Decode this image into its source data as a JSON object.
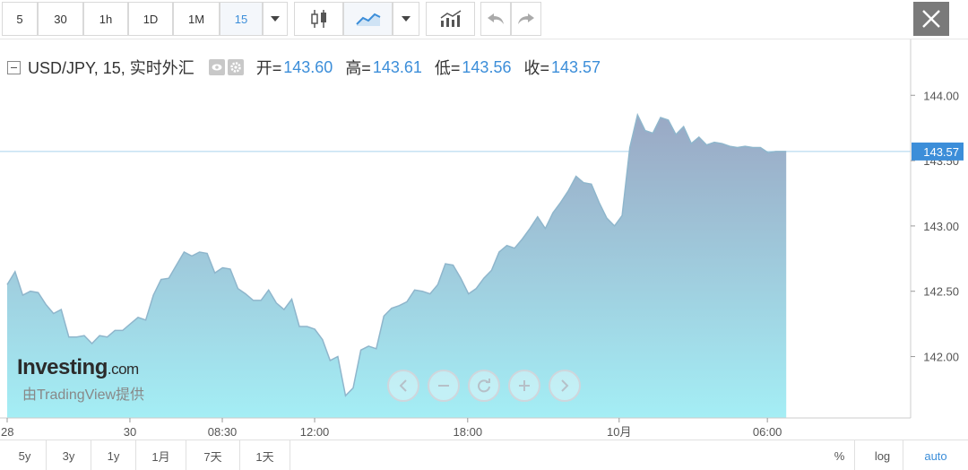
{
  "toolbar": {
    "intervals": [
      "5",
      "30",
      "1h",
      "1D",
      "1M",
      "15"
    ],
    "active_interval": "15"
  },
  "legend": {
    "symbol": "USD/JPY, 15, 实时外汇",
    "open_label": "开=",
    "open": "143.60",
    "high_label": "高=",
    "high": "143.61",
    "low_label": "低=",
    "low": "143.56",
    "close_label": "收=",
    "close": "143.57"
  },
  "brand": {
    "name": "Investing",
    "suffix": ".com",
    "credit": "由TradingView提供"
  },
  "bottom_bar": {
    "ranges": [
      "5y",
      "3y",
      "1y",
      "1月",
      "7天",
      "1天"
    ],
    "scale_options": [
      "%",
      "log",
      "auto"
    ],
    "active_scale": "auto"
  },
  "colors": {
    "accent": "#3c8ed9",
    "area_top": "#9aa8c4",
    "area_bottom": "#a4eef5",
    "line": "#8fb6cc"
  },
  "chart_data": {
    "type": "area",
    "title": "",
    "xlabel": "",
    "ylabel": "",
    "ylim": [
      141.53,
      144.4
    ],
    "y_ticks": [
      142.0,
      142.5,
      143.0,
      143.5,
      144.0
    ],
    "y_tick_labels": [
      "142.00",
      "142.50",
      "143.00",
      "143.50",
      "144.00"
    ],
    "last_price": 143.57,
    "last_price_label": "143.57",
    "x_ticks": [
      {
        "x": 0.0,
        "label": "28"
      },
      {
        "x": 25.45,
        "label": "30"
      },
      {
        "x": 44.6,
        "label": "08:30"
      },
      {
        "x": 63.74,
        "label": "12:00"
      },
      {
        "x": 95.47,
        "label": "18:00"
      },
      {
        "x": 126.87,
        "label": "10月"
      },
      {
        "x": 157.6,
        "label": "06:00"
      }
    ],
    "series": [
      {
        "x": [
          0,
          1.64,
          3.23,
          4.82,
          6.42,
          8.01,
          9.6,
          11.2,
          12.79,
          14.38,
          15.98,
          17.57,
          19.16,
          20.75,
          22.35,
          23.94,
          25.53,
          27.13,
          28.72,
          30.31,
          31.91,
          33.5,
          35.09,
          36.68,
          38.28,
          39.87,
          41.46,
          43.06,
          44.65,
          46.24,
          47.84,
          49.43,
          51.02,
          52.62,
          54.21,
          55.8,
          57.39,
          58.99,
          60.58,
          62.17,
          63.77,
          65.36,
          66.95,
          68.55,
          70.14,
          71.73,
          73.33,
          74.92,
          76.51,
          78.1,
          79.7,
          81.29,
          82.88,
          84.48,
          86.07,
          87.66,
          89.26,
          90.85,
          92.44,
          94.04,
          95.63,
          97.22,
          98.81,
          100.41,
          102,
          103.59,
          105.19,
          106.78,
          108.37,
          109.97,
          111.56,
          113.15,
          114.74,
          116.34,
          117.93,
          119.52,
          121.12,
          122.71,
          124.3,
          125.9,
          127.49,
          129.08,
          130.68,
          132.27,
          133.86,
          135.45,
          137.05,
          138.64,
          140.23,
          141.83,
          143.42,
          145.01,
          146.61,
          148.2,
          149.79,
          151.39,
          152.98,
          154.57,
          156.16,
          157.76,
          159.35,
          160.94,
          161.5
        ],
        "y": [
          142.55,
          142.65,
          142.47,
          142.5,
          142.49,
          142.4,
          142.33,
          142.36,
          142.15,
          142.15,
          142.16,
          142.1,
          142.16,
          142.15,
          142.2,
          142.2,
          142.25,
          142.3,
          142.28,
          142.47,
          142.59,
          142.6,
          142.7,
          142.8,
          142.77,
          142.8,
          142.79,
          142.64,
          142.68,
          142.67,
          142.52,
          142.48,
          142.43,
          142.43,
          142.51,
          142.41,
          142.36,
          142.44,
          142.23,
          142.23,
          142.21,
          142.13,
          141.97,
          142.0,
          141.7,
          141.76,
          142.05,
          142.08,
          142.06,
          142.31,
          142.37,
          142.39,
          142.42,
          142.51,
          142.5,
          142.48,
          142.55,
          142.71,
          142.7,
          142.6,
          142.48,
          142.52,
          142.6,
          142.66,
          142.8,
          142.85,
          142.83,
          142.9,
          142.98,
          143.07,
          142.98,
          143.1,
          143.18,
          143.27,
          143.38,
          143.33,
          143.32,
          143.18,
          143.06,
          143.0,
          143.08,
          143.6,
          143.85,
          143.73,
          143.71,
          143.83,
          143.81,
          143.7,
          143.76,
          143.63,
          143.68,
          143.62,
          143.64,
          143.63,
          143.61,
          143.6,
          143.61,
          143.6,
          143.6,
          143.56,
          143.57,
          143.57,
          143.57
        ]
      }
    ]
  }
}
